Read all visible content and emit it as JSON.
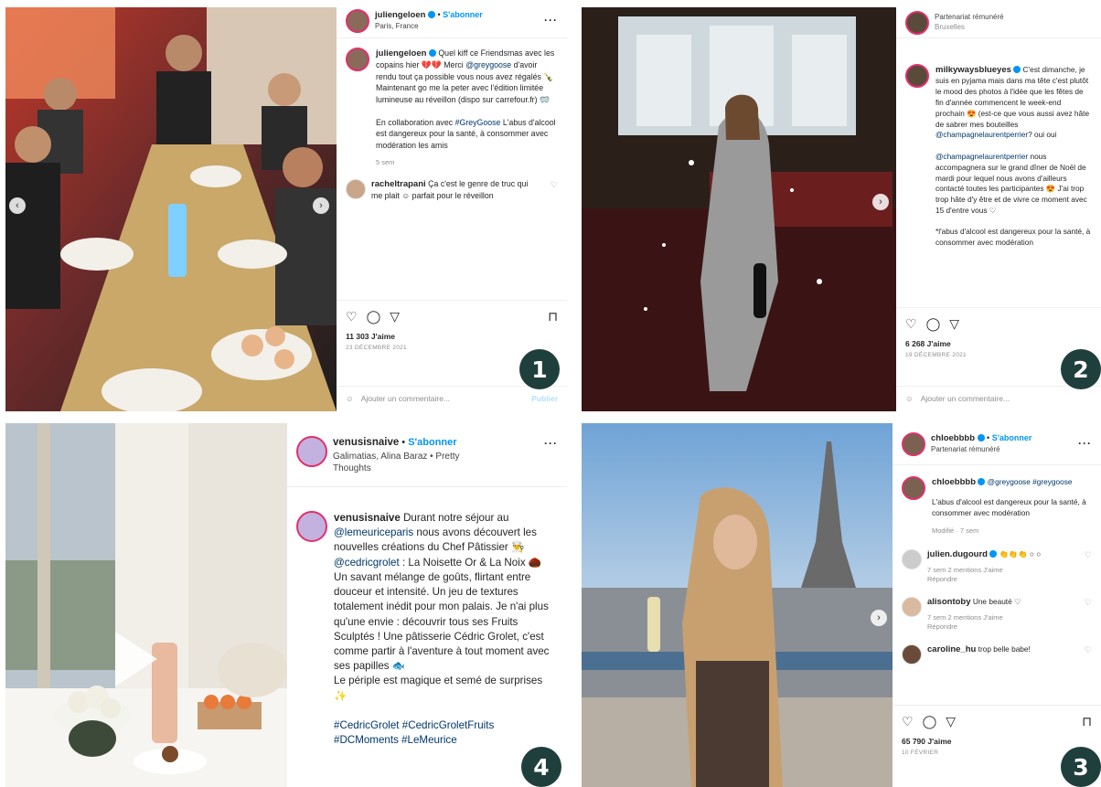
{
  "badges": [
    "1",
    "2",
    "4",
    "3"
  ],
  "card1": {
    "username": "juliengeloen",
    "follow": "S'abonner",
    "location": "Paris, France",
    "caption_user": "juliengeloen",
    "caption": "Quel kiff ce Friendsmas avec les copains hier 💔💔 Merci",
    "mention": "@greygoose",
    "caption2": "d'avoir rendu tout ça possible vous nous avez régalés 🍾 Maintenant go me la peter avec l'édition limitée lumineuse au réveillon (dispo sur carrefour.fr) 🥽",
    "collab_prefix": "En collaboration avec",
    "collab_tag": "#GreyGoose",
    "disclaimer": "L'abus d'alcool est dangereux pour la santé, à consommer avec modération les amis",
    "time": "5 sem",
    "comment_user": "racheltrapani",
    "comment_text": "Ça c'est le genre de truc qui me plait ☺ parfait pour le réveillon",
    "likes": "11 303 J'aime",
    "date": "23 DÉCEMBRE 2021",
    "add_comment": "Ajouter un commentaire...",
    "publish": "Publier"
  },
  "card2": {
    "partner": "Partenariat rémunéré",
    "location": "Bruxelles",
    "caption_user": "milkywaysblueyes",
    "caption": "C'est dimanche, je suis en pyjama mais dans ma tête c'est plutôt le mood des photos à l'idée que les fêtes de fin d'année commencent le week-end prochain 😍 (est-ce que vous aussi avez hâte de sabrer mes bouteilles",
    "mention": "@champagnelaurentperrier",
    "caption_end": "? oui oui",
    "mention2": "@champagnelaurentperrier",
    "caption2": "nous accompagnera sur le grand dîner de Noël de mardi pour lequel nous avons d'ailleurs contacté toutes les participantes 😍 J'ai trop trop hâte d'y être et de vivre ce moment avec 15 d'entre vous ♡",
    "disclaimer": "*l'abus d'alcool est dangereux pour la santé, à consommer avec modération",
    "likes": "6 268 J'aime",
    "date": "19 DÉCEMBRE 2021",
    "add_comment": "Ajouter un commentaire..."
  },
  "card4": {
    "username": "venusisnaive",
    "follow": "S'abonner",
    "audio": "Galimatias, Alina Baraz • Pretty Thoughts",
    "caption_user": "venusisnaive",
    "caption": "Durant notre séjour au",
    "mention": "@lemeuriceparis",
    "caption2": "nous avons découvert les nouvelles créations du Chef Pâtissier 👨‍🍳",
    "mention2": "@cedricgrolet",
    "caption3": ": La Noisette Or & La Noix 🌰",
    "caption4": "Un savant mélange de goûts, flirtant entre douceur et intensité. Un jeu de textures totalement inédit pour mon palais. Je n'ai plus qu'une envie : découvrir tous ses Fruits Sculptés ! Une pâtisserie Cédric Grolet, c'est comme partir à l'aventure à tout moment avec ses papilles 🐟",
    "caption5": "Le périple est magique et semé de surprises ✨",
    "hashtags": "#CedricGrolet #CedricGroletFruits #DCMoments #LeMeurice"
  },
  "card3": {
    "username": "chloebbbb",
    "follow": "S'abonner",
    "partner": "Partenariat rémunéré",
    "caption_user": "chloebbbb",
    "caption": "@greygoose #greygoose",
    "disclaimer": "L'abus d'alcool est dangereux pour la santé, à consommer avec modération",
    "edited": "Modifié · 7 sem",
    "comments": [
      {
        "user": "julien.dugourd",
        "text": "👏👏👏 ○ ○",
        "meta": "7 sem   2 mentions J'aime",
        "reply": "Répondre"
      },
      {
        "user": "alisontoby",
        "text": "Une beauté ♡",
        "meta": "7 sem   2 mentions J'aime",
        "reply": "Répondre"
      },
      {
        "user": "caroline_hu",
        "text": "trop belle babe!",
        "meta": "",
        "reply": ""
      }
    ],
    "likes": "65 790 J'aime",
    "date": "10 FÉVRIER"
  },
  "colors": {
    "badge": "#1f3f3d",
    "link": "#0095f6",
    "mention": "#00376b"
  }
}
